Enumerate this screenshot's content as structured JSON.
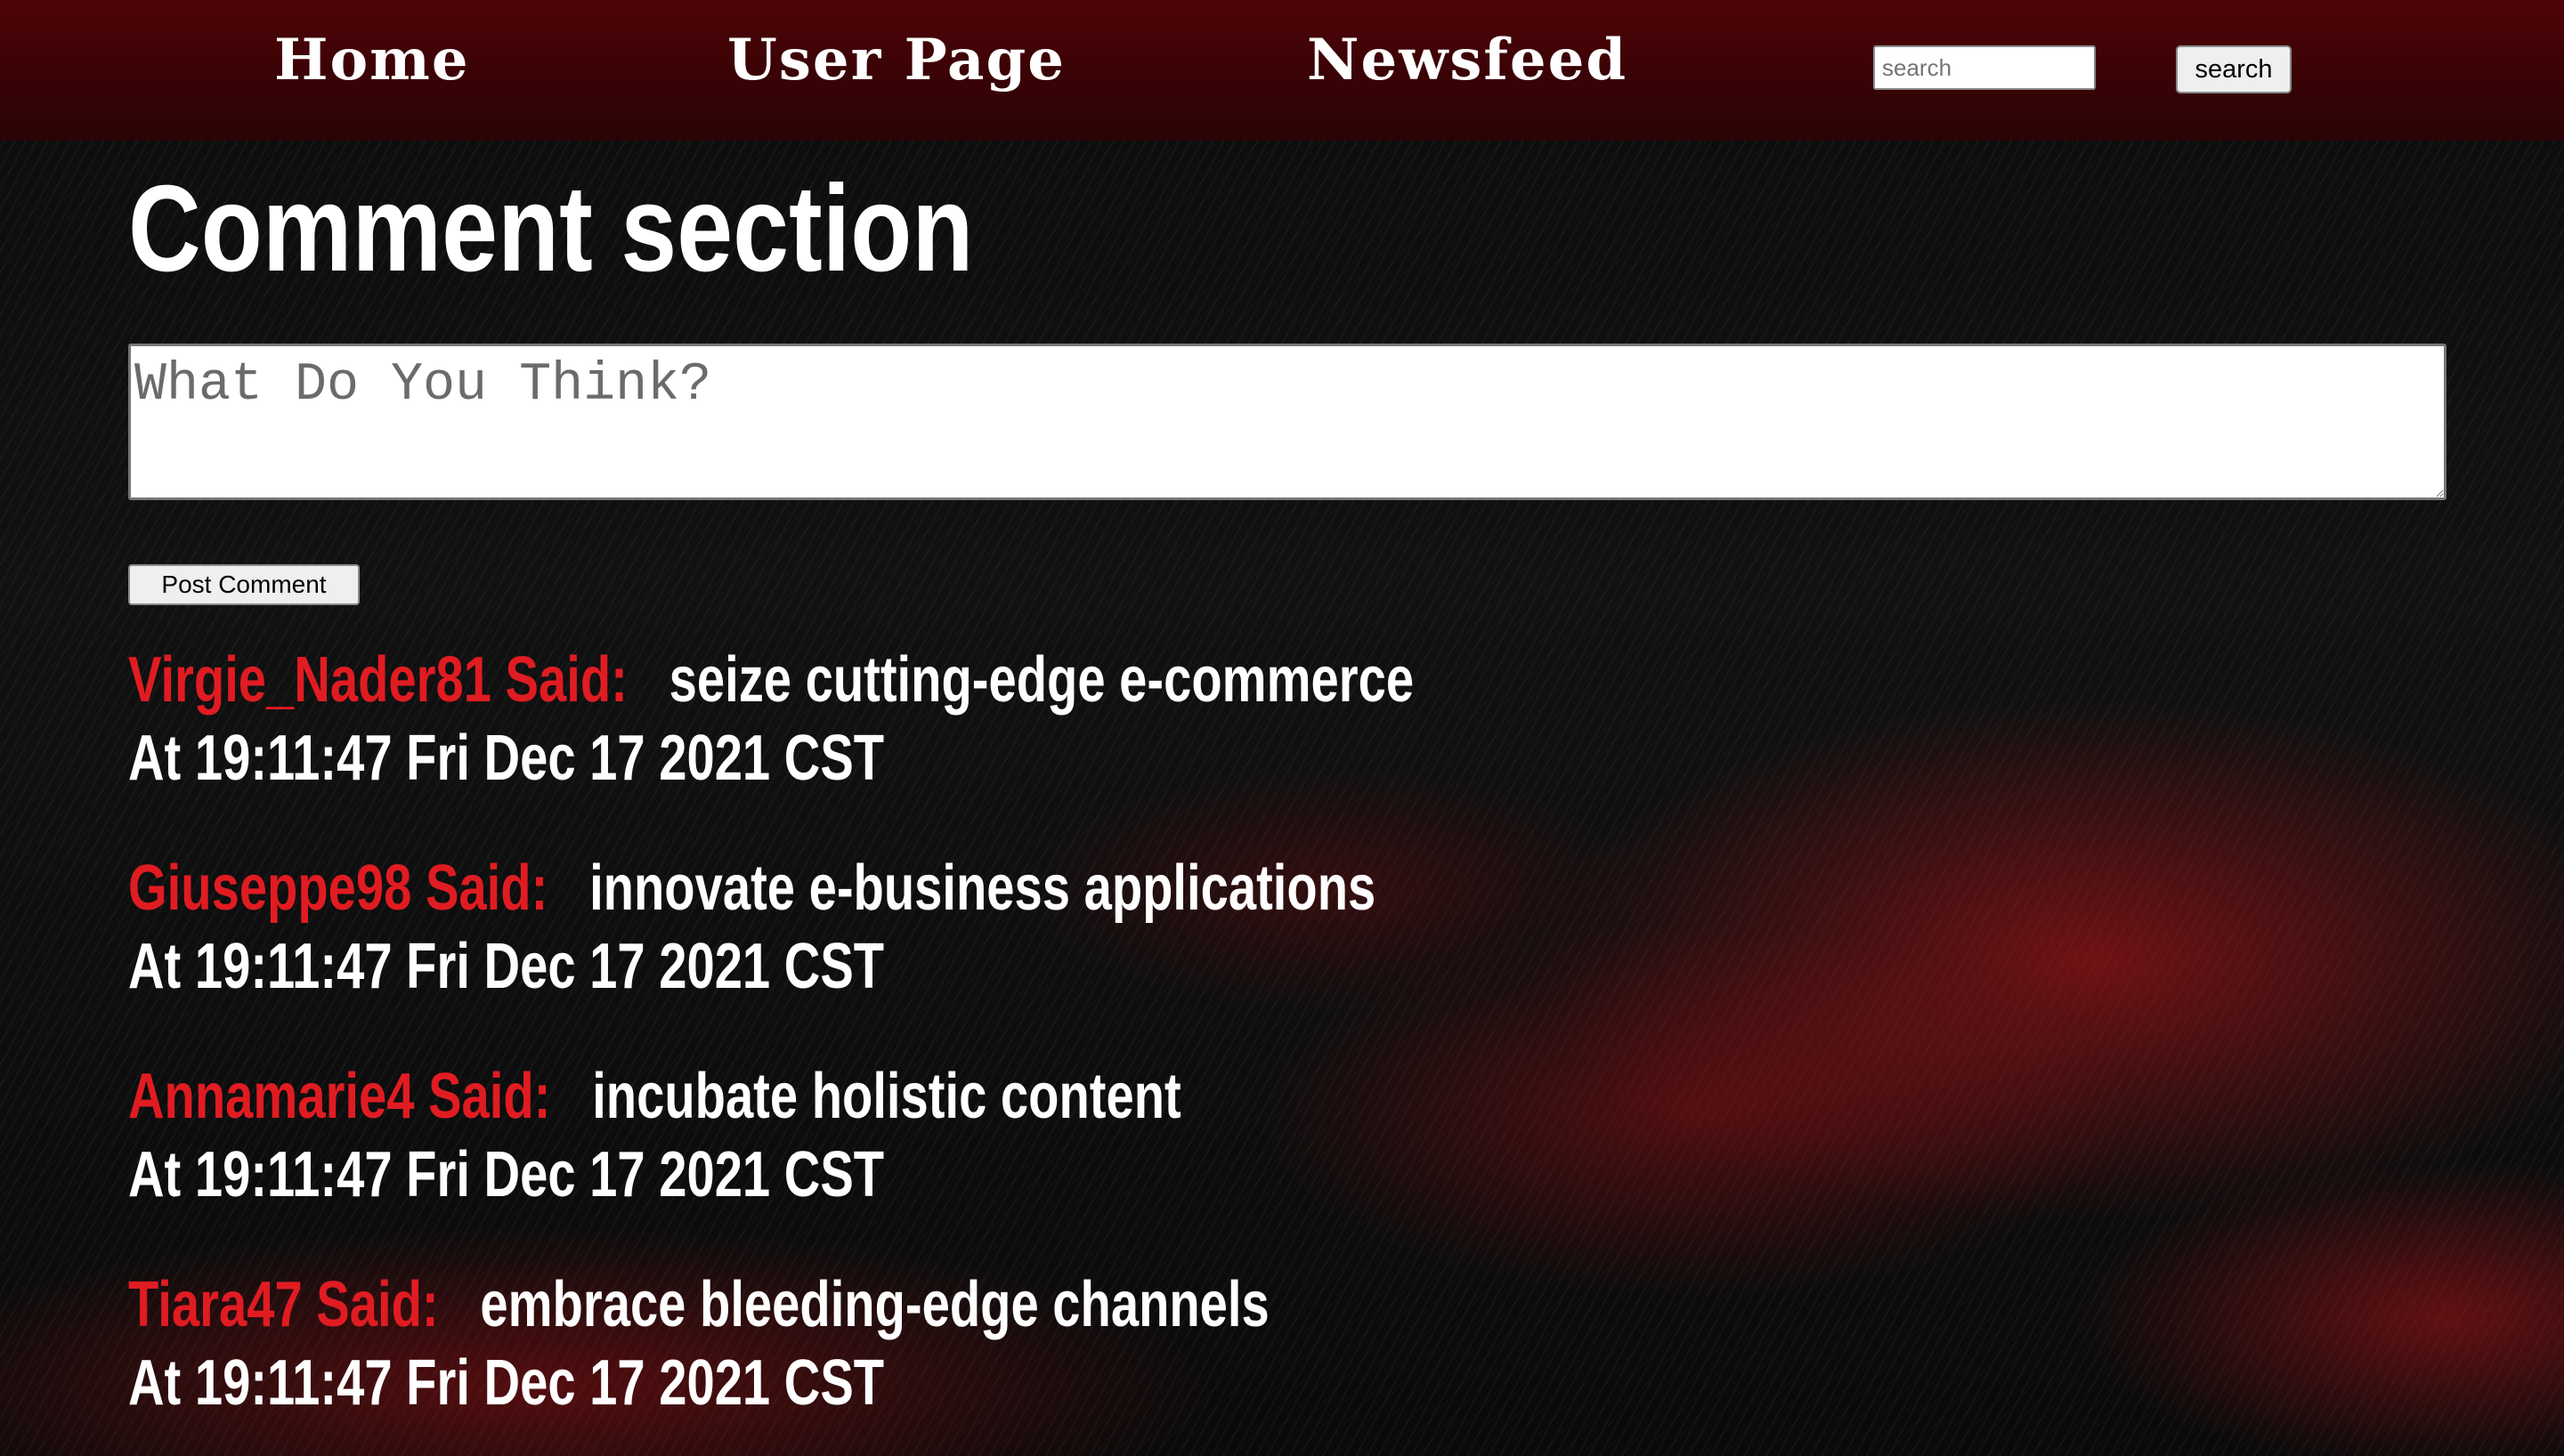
{
  "nav": {
    "home": "Home",
    "user_page": "User Page",
    "newsfeed": "Newsfeed",
    "search_placeholder": "search",
    "search_button": "search"
  },
  "main": {
    "title": "Comment section",
    "comment_placeholder": "What Do You Think?",
    "post_button": "Post Comment"
  },
  "comments": [
    {
      "author": "Virgie_Nader81 Said:",
      "text": "seize cutting-edge e-commerce",
      "time": "At 19:11:47 Fri Dec 17 2021 CST"
    },
    {
      "author": "Giuseppe98 Said:",
      "text": "innovate e-business applications",
      "time": "At 19:11:47 Fri Dec 17 2021 CST"
    },
    {
      "author": "Annamarie4 Said:",
      "text": "incubate holistic content",
      "time": "At 19:11:47 Fri Dec 17 2021 CST"
    },
    {
      "author": "Tiara47 Said:",
      "text": "embrace bleeding-edge channels",
      "time": "At 19:11:47 Fri Dec 17 2021 CST"
    }
  ],
  "colors": {
    "navbar": "#4e0408",
    "author": "#e01c22",
    "text": "#ffffff"
  }
}
